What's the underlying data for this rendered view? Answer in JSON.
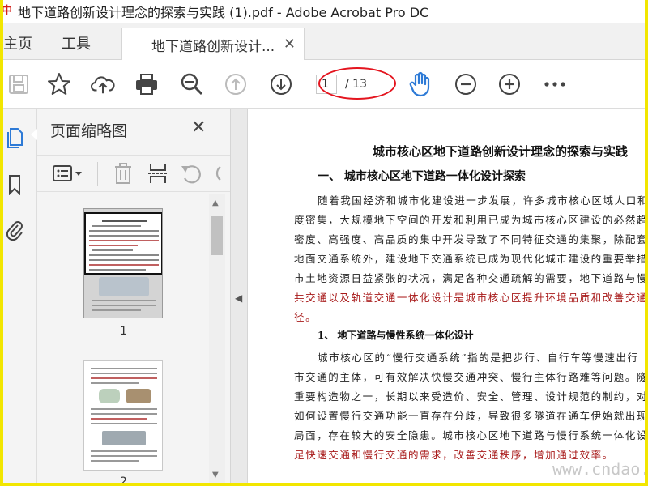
{
  "window": {
    "title": "地下道路创新设计理念的探索与实践 (1).pdf - Adobe Acrobat Pro DC"
  },
  "tabs": {
    "home": "主页",
    "tools": "工具",
    "document": "地下道路创新设计...",
    "close_symbol": "✕"
  },
  "toolbar": {
    "icons": [
      "save-icon",
      "bookmark-star-icon",
      "upload-cloud-icon",
      "print-icon",
      "zoom-search-icon",
      "page-up-icon",
      "page-down-icon",
      "hand-tool-icon",
      "zoom-out-icon",
      "zoom-in-icon",
      "more-icon"
    ],
    "page_current": "1",
    "page_total": "/ 13"
  },
  "panel": {
    "title": "页面缩略图",
    "close_symbol": "✕",
    "thumbnails": [
      {
        "page_label": "1",
        "selected": true
      },
      {
        "page_label": "2",
        "selected": false
      }
    ]
  },
  "document": {
    "title": "城市核心区地下道路创新设计理念的探索与实践",
    "heading1": "一、 城市核心区地下道路一体化设计探索",
    "paragraph1": [
      {
        "text": "随着我国经济和城市化建设进一步发展，许多城市核心区域人口和",
        "red": false
      },
      {
        "text": "度密集，大规模地下空间的开发和利用已成为城市核心区建设的必然趋",
        "red": false
      },
      {
        "text": "密度、高强度、高品质的集中开发导致了不同特征交通的集聚，除配套",
        "red": false
      },
      {
        "text": "地面交通系统外，建设地下交通系统已成为现代化城市建设的重要举措",
        "red": false
      },
      {
        "text": "市土地资源日益紧张的状况，满足各种交通疏解的需要，地下道路与慢",
        "red": false
      },
      {
        "text": "共交通以及轨道交通一体化设计是城市核心区提升环境品质和改善交通",
        "red": true
      },
      {
        "text": "径。",
        "red": true
      }
    ],
    "heading2": "1、 地下道路与慢性系统一体化设计",
    "paragraph2": [
      {
        "text": "城市核心区的“慢行交通系统”指的是把步行、自行车等慢速出行",
        "red": false
      },
      {
        "text": "市交通的主体，可有效解决快慢交通冲突、慢行主体行路难等问题。隧",
        "red": false
      },
      {
        "text": "重要构造物之一，长期以来受造价、安全、管理、设计规范的制约，对",
        "red": false
      },
      {
        "text": "如何设置慢行交通功能一直存在分歧，导致很多隧道在通车伊始就出现",
        "red": false
      },
      {
        "text": "局面，存在较大的安全隐患。城市核心区地下道路与慢行系统一体化设",
        "red": false
      },
      {
        "text": "足快速交通和慢行交通的需求，改善交通秩序，增加通过效率。",
        "red": true
      }
    ],
    "watermark": "www.cndao.com"
  },
  "colors": {
    "frame_border": "#f2e600",
    "accent_blue": "#2d7ad6",
    "highlight_red": "#e4151f",
    "text_red": "#a81a1a"
  }
}
